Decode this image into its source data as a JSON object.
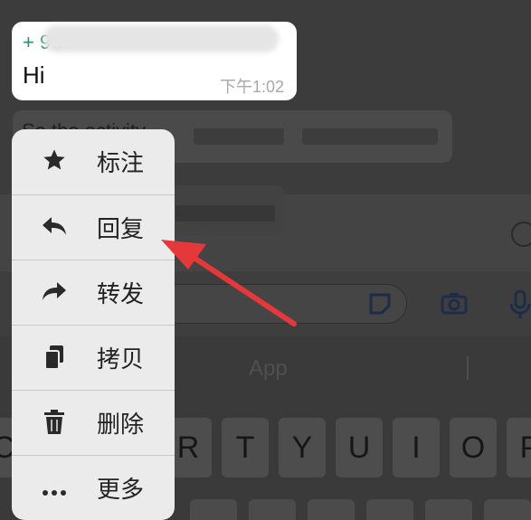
{
  "message": {
    "sender": "+ 987",
    "text": "Hi",
    "time": "下午1:02"
  },
  "background_message": {
    "text": "So the activity"
  },
  "context_menu": {
    "items": [
      {
        "label": "标注",
        "icon": "star-icon"
      },
      {
        "label": "回复",
        "icon": "reply-icon"
      },
      {
        "label": "转发",
        "icon": "forward-icon"
      },
      {
        "label": "拷贝",
        "icon": "copy-icon"
      },
      {
        "label": "删除",
        "icon": "trash-icon"
      },
      {
        "label": "更多",
        "icon": "more-icon"
      }
    ]
  },
  "keyboard": {
    "suggestion": "App",
    "keys": [
      "R",
      "T",
      "Y",
      "U",
      "I",
      "O",
      "P"
    ]
  },
  "annotation": {
    "color": "#e5383b",
    "points_to": "回复"
  }
}
